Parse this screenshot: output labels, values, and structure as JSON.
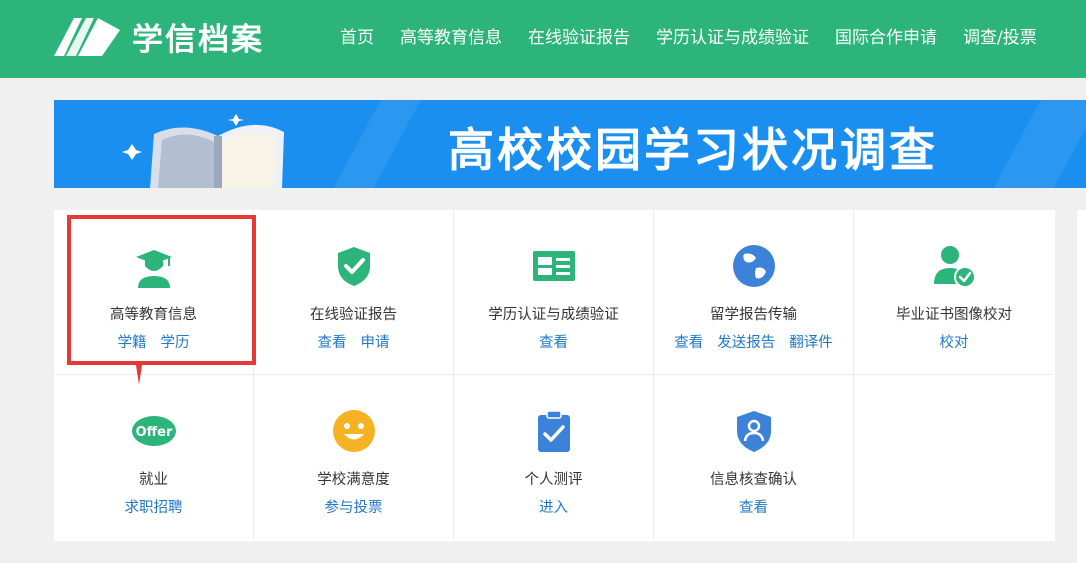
{
  "header": {
    "logo_text": "学信档案",
    "nav": [
      "首页",
      "高等教育信息",
      "在线验证报告",
      "学历认证与成绩验证",
      "国际合作申请",
      "调查/投票"
    ]
  },
  "banner": {
    "title": "高校校园学习状况调查"
  },
  "services": [
    {
      "title": "高等教育信息",
      "links": [
        "学籍",
        "学历"
      ],
      "icon": "graduate-icon"
    },
    {
      "title": "在线验证报告",
      "links": [
        "查看",
        "申请"
      ],
      "icon": "shield-check-icon"
    },
    {
      "title": "学历认证与成绩验证",
      "links": [
        "查看"
      ],
      "icon": "id-card-icon"
    },
    {
      "title": "留学报告传输",
      "links": [
        "查看",
        "发送报告",
        "翻译件"
      ],
      "icon": "globe-icon"
    },
    {
      "title": "毕业证书图像校对",
      "links": [
        "校对"
      ],
      "icon": "user-check-icon"
    },
    {
      "title": "就业",
      "links": [
        "求职招聘"
      ],
      "icon": "offer-icon",
      "icon_text": "Offer"
    },
    {
      "title": "学校满意度",
      "links": [
        "参与投票"
      ],
      "icon": "smiley-icon"
    },
    {
      "title": "个人测评",
      "links": [
        "进入"
      ],
      "icon": "clipboard-check-icon"
    },
    {
      "title": "信息核查确认",
      "links": [
        "查看"
      ],
      "icon": "shield-user-icon"
    }
  ],
  "colors": {
    "brand_green": "#2cb47a",
    "banner_blue": "#1a8ff0",
    "link_blue": "#2078c8",
    "highlight_red": "#e53935",
    "icon_orange": "#f5b324",
    "icon_blue": "#3b82d8"
  }
}
